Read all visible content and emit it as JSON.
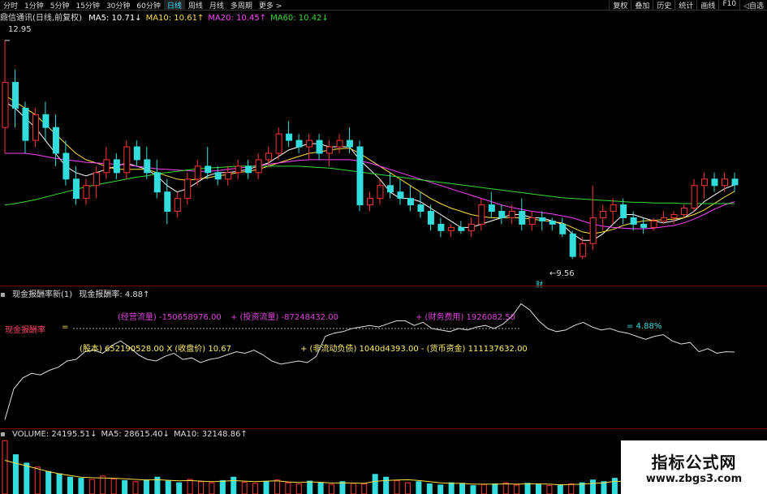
{
  "toolbar": {
    "periods": [
      "分时",
      "1分钟",
      "5分钟",
      "15分钟",
      "30分钟",
      "60分钟",
      "日线",
      "周线",
      "月线",
      "多周期",
      "更多 >"
    ],
    "active_index": 6,
    "right_buttons": [
      "复权",
      "叠加",
      "历史",
      "统计",
      "画线",
      "F10",
      "◁自选"
    ]
  },
  "main_legend": {
    "title": "鼎信通讯(日线,前复权)",
    "items": [
      {
        "label": "MA5: 10.71↓",
        "color": "#ffffff"
      },
      {
        "label": "MA10: 10.61↑",
        "color": "#ffdd44"
      },
      {
        "label": "MA20: 10.45↑",
        "color": "#ff44ff"
      },
      {
        "label": "MA60: 10.42↓",
        "color": "#33dd33"
      }
    ]
  },
  "price_labels": {
    "high": "12.95",
    "low": "9.56",
    "low_marker": "财"
  },
  "indicator_legend": {
    "name": "现金报酬率新(1)",
    "value_label": "现金报酬率: 4.88↑",
    "formula_line1_a": "(经营流量) -150658976.00",
    "formula_line1_b": "+ (投资流量) -87248432.00",
    "formula_line1_c": "+ (财务费用) 1926082.50",
    "left_label": "现金报酬率",
    "eq": "=",
    "formula_line2_a": "(股本) 652190528.00 X (收盘价) 10.67",
    "formula_line2_b": "+ (非流动负债) 1040d4393.00 - (货币资金) 111137632.00",
    "current": "= 4.88%"
  },
  "volume_legend": {
    "items": [
      {
        "label": "VOLUME: 24195.51↓",
        "color": "#dddddd"
      },
      {
        "label": "MA5: 28615.40↓",
        "color": "#dddddd"
      },
      {
        "label": "MA10: 32148.86↑",
        "color": "#dddddd"
      }
    ]
  },
  "watermark": {
    "title": "指标公式网",
    "url": "www.zbgs3.com"
  },
  "colors": {
    "up": "#ff3333",
    "down": "#33dddd",
    "ma5": "#ffffff",
    "ma10": "#ffdd44",
    "ma20": "#ff44ff",
    "ma60": "#33dd33",
    "indicator": "#dddddd",
    "formula_magenta": "#dd44dd",
    "formula_yellow": "#ffee66"
  },
  "chart_data": [
    {
      "type": "candlestick",
      "title": "鼎信通讯(日线,前复权)",
      "price_range": [
        9.3,
        13.2
      ],
      "annotations": {
        "high": 12.95,
        "low": 9.56
      },
      "candles": [
        [
          11.6,
          12.95,
          11.2,
          12.3
        ],
        [
          12.3,
          12.5,
          11.6,
          11.9
        ],
        [
          11.9,
          12.0,
          11.2,
          11.4
        ],
        [
          11.4,
          11.9,
          11.3,
          11.8
        ],
        [
          11.8,
          12.0,
          11.4,
          11.6
        ],
        [
          11.6,
          11.8,
          11.0,
          11.2
        ],
        [
          11.2,
          11.4,
          10.7,
          10.8
        ],
        [
          10.8,
          11.0,
          10.4,
          10.5
        ],
        [
          10.5,
          10.8,
          10.4,
          10.7
        ],
        [
          10.7,
          11.0,
          10.5,
          10.9
        ],
        [
          10.9,
          11.3,
          10.8,
          11.1
        ],
        [
          11.1,
          11.2,
          10.8,
          10.9
        ],
        [
          10.9,
          11.4,
          10.8,
          11.3
        ],
        [
          11.3,
          11.4,
          11.0,
          11.1
        ],
        [
          11.1,
          11.3,
          10.8,
          10.9
        ],
        [
          10.9,
          11.1,
          10.5,
          10.6
        ],
        [
          10.6,
          10.8,
          10.1,
          10.3
        ],
        [
          10.3,
          10.6,
          10.2,
          10.5
        ],
        [
          10.5,
          10.9,
          10.4,
          10.8
        ],
        [
          10.8,
          11.1,
          10.7,
          11.0
        ],
        [
          11.0,
          11.3,
          10.8,
          10.9
        ],
        [
          10.9,
          11.0,
          10.7,
          10.8
        ],
        [
          10.8,
          11.0,
          10.7,
          10.9
        ],
        [
          10.9,
          11.1,
          10.8,
          11.0
        ],
        [
          11.0,
          11.1,
          10.8,
          10.9
        ],
        [
          10.9,
          11.2,
          10.8,
          11.1
        ],
        [
          11.1,
          11.3,
          11.0,
          11.2
        ],
        [
          11.2,
          11.6,
          11.1,
          11.5
        ],
        [
          11.5,
          11.7,
          11.3,
          11.4
        ],
        [
          11.4,
          11.5,
          11.2,
          11.3
        ],
        [
          11.3,
          11.5,
          11.1,
          11.4
        ],
        [
          11.4,
          11.5,
          11.1,
          11.2
        ],
        [
          11.2,
          11.4,
          11.0,
          11.3
        ],
        [
          11.3,
          11.5,
          11.2,
          11.4
        ],
        [
          11.4,
          11.6,
          11.2,
          11.3
        ],
        [
          11.3,
          11.4,
          10.3,
          10.4
        ],
        [
          10.4,
          10.6,
          10.3,
          10.5
        ],
        [
          10.5,
          10.8,
          10.4,
          10.7
        ],
        [
          10.7,
          10.9,
          10.5,
          10.6
        ],
        [
          10.6,
          10.8,
          10.4,
          10.5
        ],
        [
          10.5,
          10.7,
          10.3,
          10.4
        ],
        [
          10.4,
          10.6,
          10.2,
          10.3
        ],
        [
          10.3,
          10.4,
          10.0,
          10.1
        ],
        [
          10.1,
          10.2,
          9.9,
          10.0
        ],
        [
          10.0,
          10.1,
          9.9,
          10.05
        ],
        [
          10.05,
          10.15,
          9.95,
          10.0
        ],
        [
          10.0,
          10.2,
          9.9,
          10.1
        ],
        [
          10.1,
          10.5,
          10.0,
          10.4
        ],
        [
          10.4,
          10.6,
          10.2,
          10.3
        ],
        [
          10.3,
          10.4,
          10.1,
          10.2
        ],
        [
          10.2,
          10.4,
          10.1,
          10.3
        ],
        [
          10.3,
          10.5,
          10.0,
          10.1
        ],
        [
          10.1,
          10.3,
          10.0,
          10.2
        ],
        [
          10.2,
          10.3,
          10.0,
          10.15
        ],
        [
          10.15,
          10.2,
          10.0,
          10.1
        ],
        [
          10.1,
          10.2,
          9.9,
          9.95
        ],
        [
          9.95,
          10.0,
          9.56,
          9.6
        ],
        [
          9.6,
          9.9,
          9.56,
          9.8
        ],
        [
          9.8,
          10.7,
          9.7,
          10.2
        ],
        [
          10.2,
          10.4,
          10.0,
          10.3
        ],
        [
          10.3,
          10.5,
          10.1,
          10.4
        ],
        [
          10.4,
          10.5,
          10.1,
          10.2
        ],
        [
          10.2,
          10.3,
          10.0,
          10.1
        ],
        [
          10.1,
          10.2,
          9.95,
          10.05
        ],
        [
          10.05,
          10.2,
          10.0,
          10.15
        ],
        [
          10.15,
          10.3,
          10.1,
          10.2
        ],
        [
          10.2,
          10.3,
          10.1,
          10.25
        ],
        [
          10.25,
          10.4,
          10.2,
          10.35
        ],
        [
          10.35,
          10.8,
          10.3,
          10.7
        ],
        [
          10.7,
          10.9,
          10.5,
          10.8
        ],
        [
          10.8,
          10.9,
          10.6,
          10.7
        ],
        [
          10.7,
          10.9,
          10.6,
          10.8
        ],
        [
          10.8,
          10.9,
          10.6,
          10.71
        ]
      ],
      "ma_series": [
        {
          "name": "MA5",
          "color": "#ffffff",
          "values": [
            12.0,
            11.9,
            11.75,
            11.6,
            11.4,
            11.2,
            11.0,
            10.9,
            10.85,
            10.9,
            10.95,
            11.0,
            11.05,
            11.0,
            10.95,
            10.85,
            10.7,
            10.6,
            10.65,
            10.75,
            10.85,
            10.9,
            10.9,
            10.92,
            10.95,
            11.0,
            11.05,
            11.15,
            11.25,
            11.3,
            11.35,
            11.35,
            11.3,
            11.3,
            11.3,
            11.1,
            10.95,
            10.8,
            10.6,
            10.5,
            10.5,
            10.45,
            10.35,
            10.25,
            10.15,
            10.05,
            10.05,
            10.1,
            10.15,
            10.2,
            10.25,
            10.25,
            10.2,
            10.2,
            10.15,
            10.1,
            9.95,
            9.85,
            9.85,
            9.95,
            10.1,
            10.25,
            10.25,
            10.2,
            10.15,
            10.12,
            10.15,
            10.2,
            10.3,
            10.45,
            10.55,
            10.65,
            10.71
          ]
        },
        {
          "name": "MA10",
          "color": "#ffdd44",
          "values": [
            12.1,
            12.0,
            11.9,
            11.8,
            11.65,
            11.5,
            11.35,
            11.2,
            11.1,
            11.05,
            11.0,
            10.95,
            10.95,
            10.95,
            10.95,
            10.9,
            10.85,
            10.8,
            10.78,
            10.8,
            10.82,
            10.85,
            10.87,
            10.9,
            10.92,
            10.95,
            11.0,
            11.05,
            11.1,
            11.15,
            11.2,
            11.22,
            11.25,
            11.27,
            11.28,
            11.2,
            11.1,
            11.0,
            10.9,
            10.8,
            10.7,
            10.6,
            10.5,
            10.42,
            10.35,
            10.3,
            10.25,
            10.22,
            10.2,
            10.2,
            10.2,
            10.2,
            10.18,
            10.16,
            10.14,
            10.12,
            10.05,
            9.98,
            9.95,
            9.98,
            10.02,
            10.08,
            10.12,
            10.15,
            10.16,
            10.17,
            10.18,
            10.2,
            10.25,
            10.32,
            10.42,
            10.52,
            10.61
          ]
        },
        {
          "name": "MA20",
          "color": "#ff44ff",
          "values": [
            11.2,
            11.2,
            11.2,
            11.18,
            11.15,
            11.12,
            11.1,
            11.08,
            11.06,
            11.05,
            11.04,
            11.03,
            11.02,
            11.0,
            10.98,
            10.96,
            10.95,
            10.94,
            10.93,
            10.92,
            10.92,
            10.93,
            10.95,
            10.97,
            10.99,
            11.01,
            11.03,
            11.05,
            11.07,
            11.09,
            11.1,
            11.1,
            11.1,
            11.1,
            11.1,
            11.08,
            11.05,
            11.0,
            10.95,
            10.9,
            10.85,
            10.8,
            10.75,
            10.7,
            10.65,
            10.6,
            10.55,
            10.5,
            10.45,
            10.4,
            10.36,
            10.33,
            10.3,
            10.28,
            10.26,
            10.23,
            10.2,
            10.15,
            10.1,
            10.07,
            10.05,
            10.04,
            10.03,
            10.03,
            10.04,
            10.06,
            10.08,
            10.12,
            10.18,
            10.25,
            10.33,
            10.4,
            10.45
          ]
        },
        {
          "name": "MA60",
          "color": "#33dd33",
          "values": [
            10.4,
            10.42,
            10.45,
            10.48,
            10.52,
            10.56,
            10.6,
            10.64,
            10.68,
            10.71,
            10.74,
            10.77,
            10.8,
            10.83,
            10.85,
            10.88,
            10.9,
            10.92,
            10.94,
            10.96,
            10.97,
            10.98,
            10.99,
            11.0,
            11.0,
            11.0,
            11.0,
            11.0,
            11.0,
            11.0,
            10.99,
            10.98,
            10.97,
            10.95,
            10.93,
            10.91,
            10.89,
            10.87,
            10.85,
            10.83,
            10.81,
            10.79,
            10.77,
            10.75,
            10.73,
            10.71,
            10.69,
            10.67,
            10.65,
            10.63,
            10.61,
            10.59,
            10.57,
            10.55,
            10.53,
            10.51,
            10.5,
            10.49,
            10.48,
            10.47,
            10.46,
            10.45,
            10.44,
            10.44,
            10.43,
            10.43,
            10.43,
            10.42,
            10.42,
            10.42,
            10.42,
            10.42,
            10.42
          ]
        }
      ]
    },
    {
      "type": "line",
      "title": "现金报酬率新(1)",
      "values": [
        0.5,
        2.5,
        3.2,
        3.5,
        3.4,
        3.7,
        3.9,
        4.3,
        4.4,
        4.9,
        5.0,
        4.8,
        5.3,
        5.6,
        5.2,
        4.7,
        4.4,
        4.3,
        4.6,
        4.8,
        4.4,
        4.5,
        4.2,
        4.4,
        4.5,
        4.7,
        4.9,
        4.8,
        5.0,
        4.7,
        4.3,
        4.1,
        4.2,
        4.3,
        4.2,
        4.6,
        5.9,
        6.1,
        6.2,
        6.4,
        6.5,
        6.6,
        6.5,
        6.7,
        6.9,
        6.9,
        6.6,
        6.8,
        6.4,
        6.3,
        6.2,
        6.4,
        6.3,
        6.5,
        6.6,
        6.4,
        6.7,
        7.2,
        8.0,
        7.6,
        6.9,
        6.4,
        6.2,
        6.3,
        6.6,
        6.8,
        6.5,
        6.3,
        6.4,
        6.2,
        6.1,
        5.9,
        5.7,
        5.9,
        6.0,
        5.6,
        5.4,
        5.5,
        4.9,
        5.1,
        4.8,
        4.9,
        4.88
      ],
      "ylim": [
        0,
        8.5
      ],
      "last_value": 4.88
    },
    {
      "type": "bar",
      "title": "VOLUME",
      "values": [
        95000,
        70000,
        55000,
        48000,
        40000,
        36000,
        30000,
        28000,
        26000,
        32000,
        27000,
        24000,
        22000,
        25000,
        30000,
        23000,
        20000,
        26000,
        22000,
        20000,
        24000,
        30000,
        21000,
        19000,
        22000,
        25000,
        20000,
        18000,
        23000,
        20000,
        17000,
        22000,
        19000,
        18000,
        35000,
        30000,
        24000,
        20000,
        22000,
        18000,
        16000,
        20000,
        19000,
        15000,
        17000,
        18000,
        20000,
        16000,
        19000,
        17000,
        15000,
        16000,
        18000,
        20000,
        25000,
        22000,
        28000,
        19000,
        21000,
        24000,
        18000,
        20000,
        22000,
        19000,
        24000,
        21000,
        20000,
        24195
      ],
      "ma5": [
        60000,
        55000,
        50000,
        45000,
        40000,
        36000,
        33000,
        30000,
        29000,
        28500,
        28000,
        27000,
        26000,
        25000,
        25500,
        24500,
        23500,
        24000,
        23000,
        22000,
        22500,
        24000,
        23000,
        22000,
        23000,
        23500,
        21500,
        20500,
        21500,
        21000,
        19500,
        20000,
        19500,
        19000,
        22500,
        24000,
        25000,
        25500,
        24000,
        22000,
        20000,
        19000,
        19000,
        17500,
        17500,
        17500,
        18000,
        17500,
        18000,
        18000,
        17500,
        16500,
        17000,
        17500,
        19000,
        20000,
        22500,
        22500,
        23000,
        23500,
        22000,
        20500,
        21000,
        20500,
        21500,
        21500,
        21000,
        28615
      ],
      "last_volume": 24195.51
    }
  ]
}
